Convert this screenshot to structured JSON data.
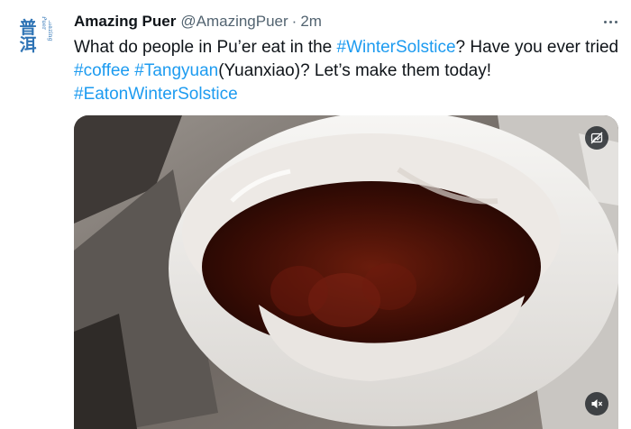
{
  "author": {
    "display_name": "Amazing Puer",
    "handle": "@AmazingPuer",
    "separator": "·",
    "time": "2m",
    "avatar": {
      "logo_glyph": "普洱",
      "logo_subtext": "Amazing Puer"
    }
  },
  "tweet": {
    "line1_text": "What do people in Pu’er eat in the ",
    "hashtag_winter_solstice": "#WinterSolstice",
    "line1_tail": "? Have you ever tried",
    "hashtag_coffee": "#coffee",
    "space": " ",
    "hashtag_tangyuan": "#Tangyuan",
    "line2_tail": "(Yuanxiao)? Let’s make them today!",
    "hashtag_eaton": "#EatonWinterSolstice"
  },
  "media": {
    "alt_icon": "hide-media-icon",
    "mute_icon": "speaker-muted-icon"
  },
  "colors": {
    "link": "#1d9bf0",
    "text": "#0f1419",
    "secondary": "#536471",
    "brand_logo": "#2f74b5"
  }
}
